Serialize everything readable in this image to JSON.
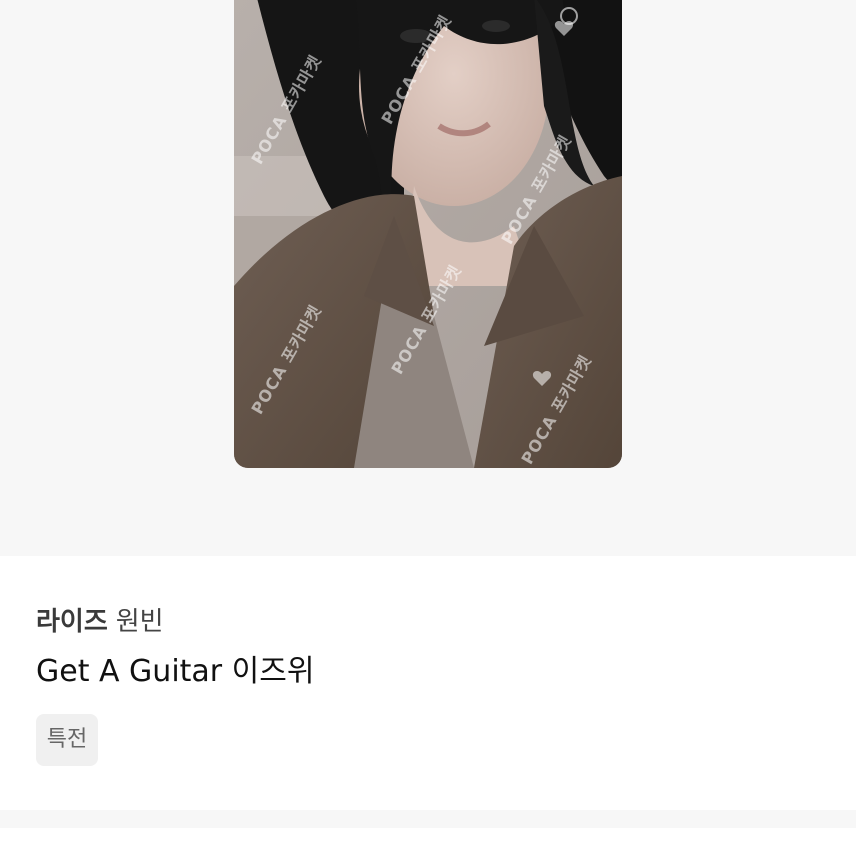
{
  "photo": {
    "watermark_text": "POCA 포카마켓"
  },
  "product": {
    "group": "라이즈",
    "member": "원빈",
    "title": "Get A Guitar 이즈위",
    "tag": "특전"
  },
  "colors": {
    "background": "#f7f7f7",
    "info_background": "#ffffff",
    "tag_background": "#f0f0f0"
  }
}
